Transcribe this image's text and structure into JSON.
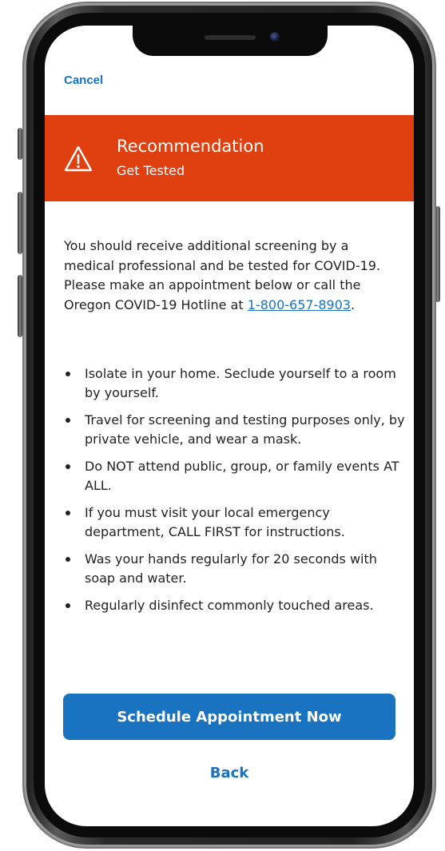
{
  "header": {
    "cancel_label": "Cancel"
  },
  "banner": {
    "icon": "warning-triangle-icon",
    "title": "Recommendation",
    "subtitle": "Get Tested",
    "color": "#e0400f"
  },
  "intro": {
    "text_before_link": "You should receive additional screening by a medical professional and be tested for COVID-19. Please make an appointment below or call the Oregon COVID-19 Hotline at ",
    "phone_link": "1-800-657-8903",
    "text_after_link": "."
  },
  "bullets": [
    "Isolate in your home. Seclude yourself to a room by yourself.",
    "Travel for screening and testing purposes only, by private vehicle, and wear a mask.",
    "Do NOT attend public, group, or family events AT ALL.",
    "If you must visit your local emergency department, CALL FIRST for instructions.",
    "Was your hands regularly for 20 seconds with soap and water.",
    "Regularly disinfect commonly touched areas."
  ],
  "actions": {
    "primary_label": "Schedule Appointment Now",
    "secondary_label": "Back",
    "accent_color": "#1a73c0"
  }
}
